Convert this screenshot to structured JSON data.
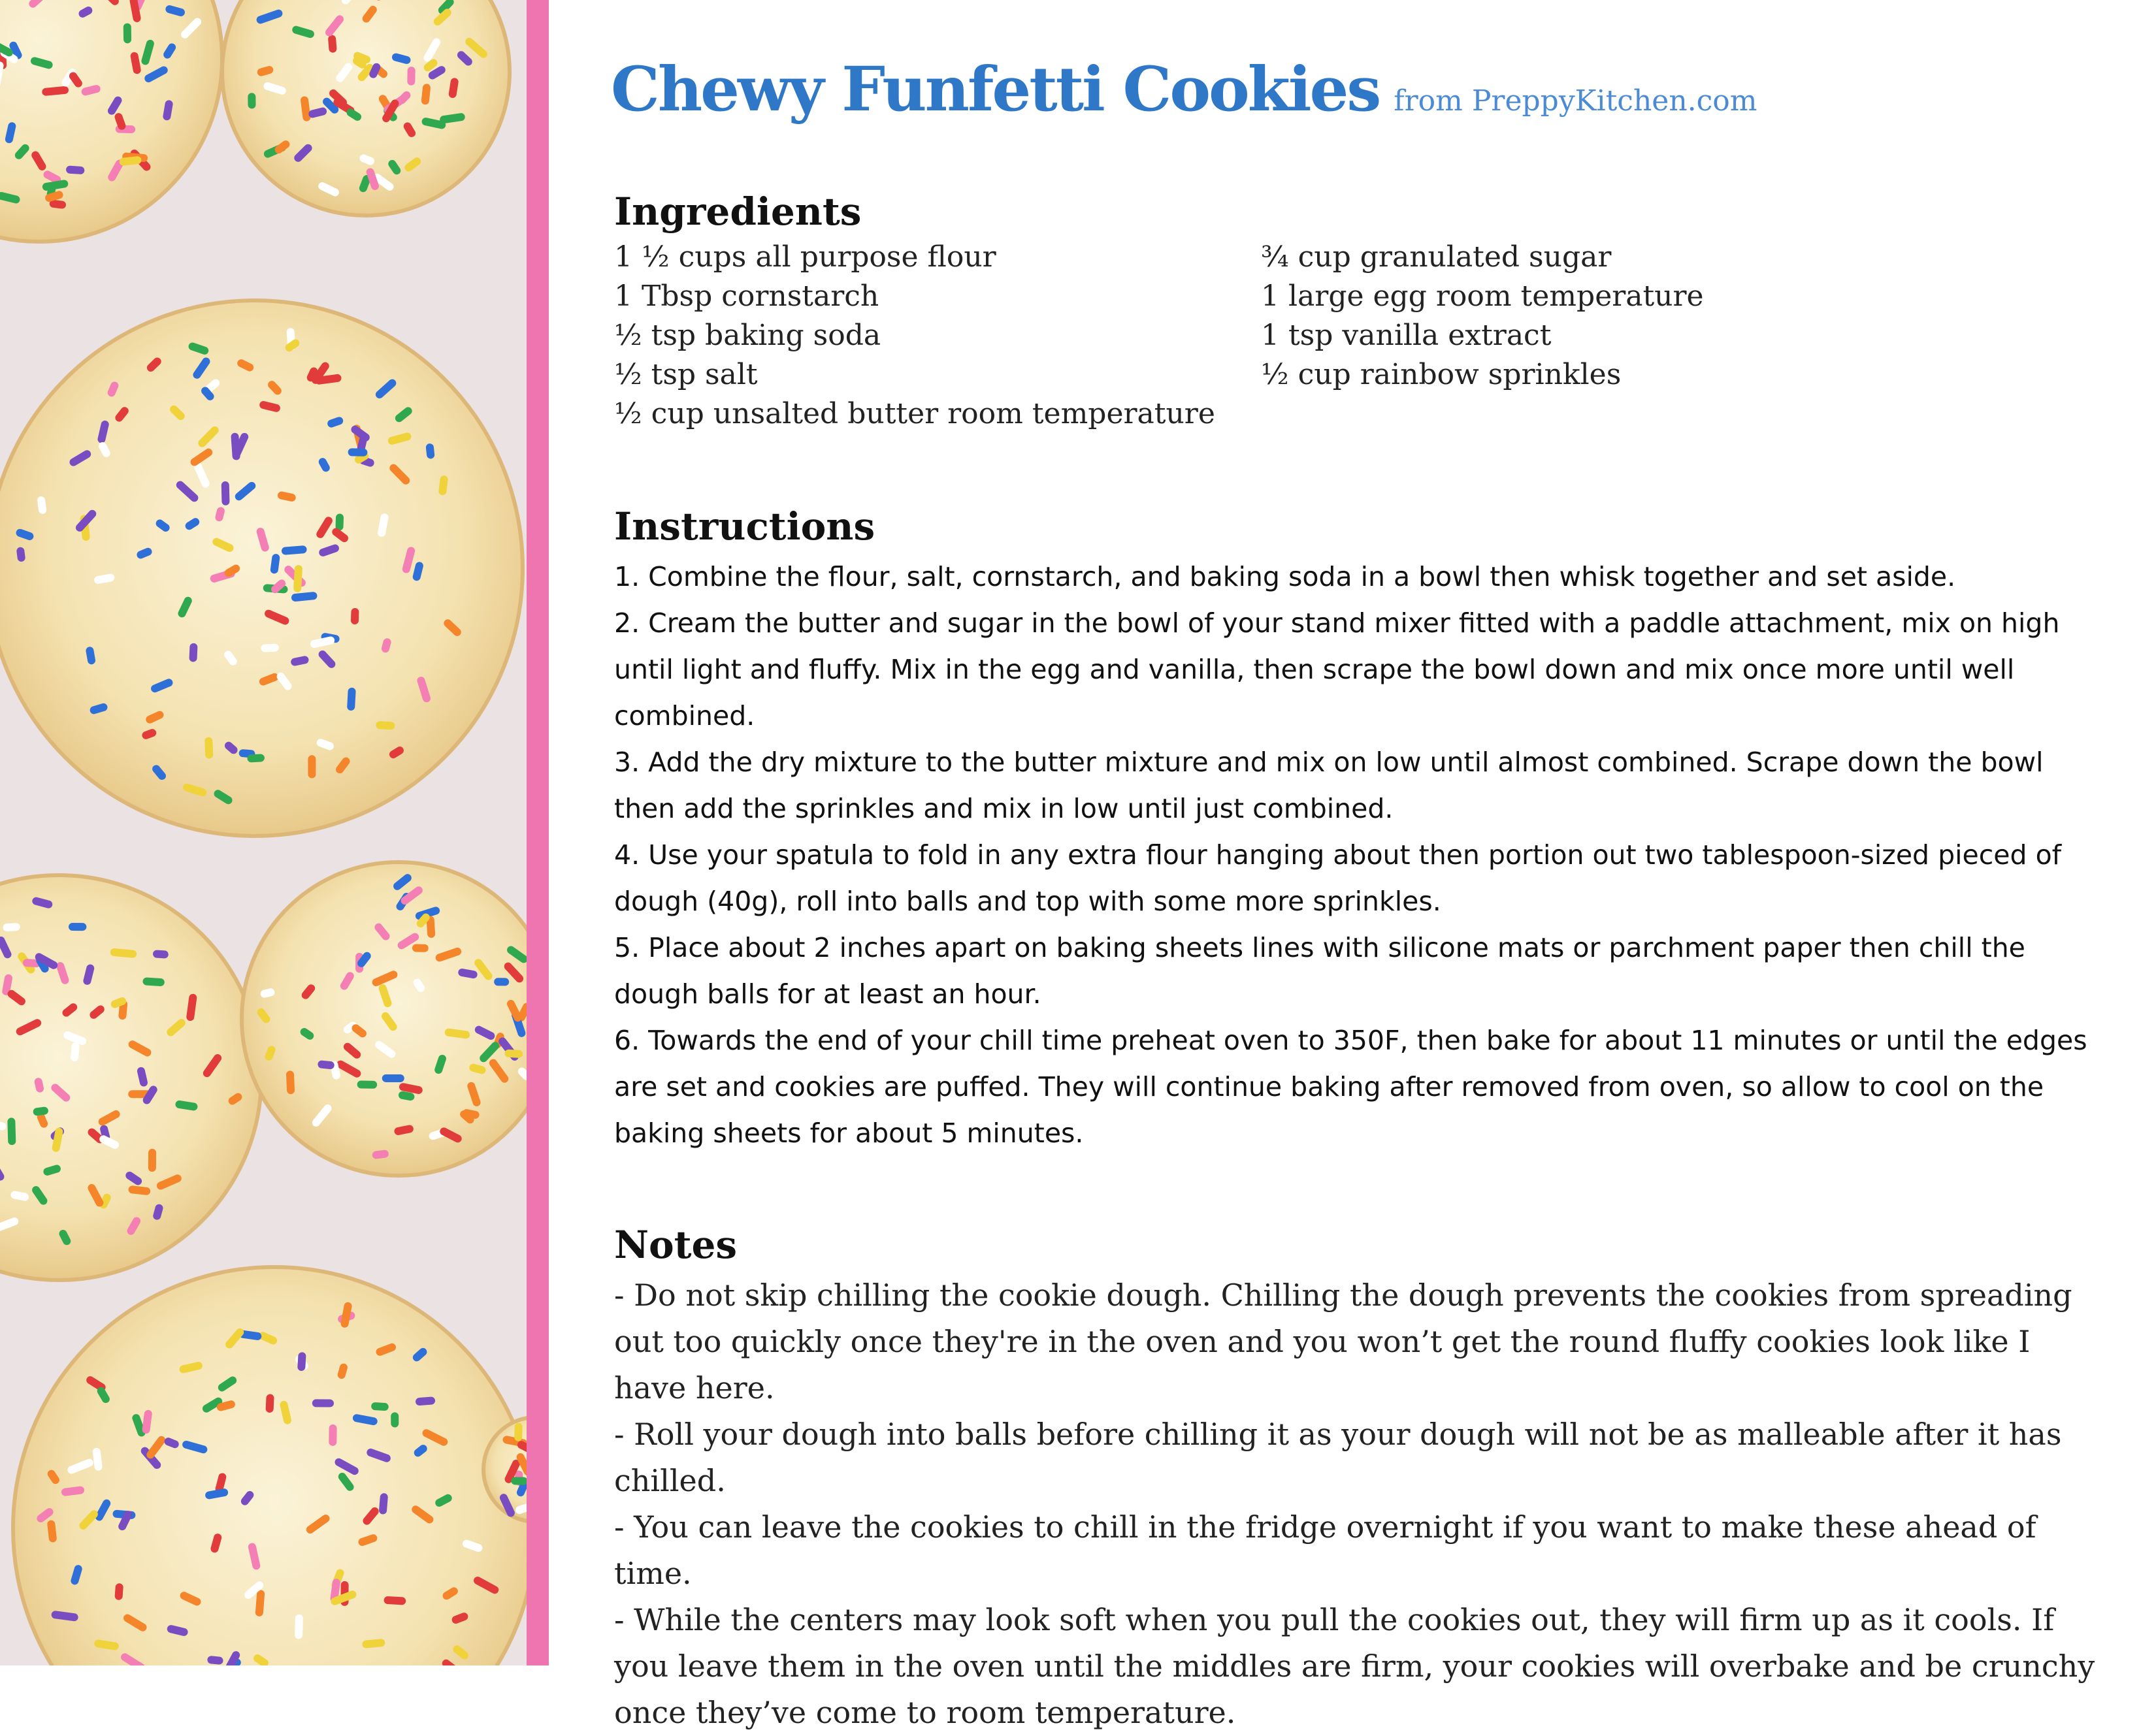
{
  "header": {
    "title": "Chewy Funfetti Cookies",
    "source": "from PreppyKitchen.com"
  },
  "photo": {
    "alt": "funfetti-cookies-photo",
    "accent_stripe_color": "#ef75b0"
  },
  "ingredients": {
    "heading": "Ingredients",
    "left": [
      "1 ½ cups all purpose flour",
      "1 Tbsp cornstarch",
      "½ tsp baking soda",
      "½ tsp salt",
      "½ cup unsalted butter room temperature"
    ],
    "right": [
      "¾ cup granulated sugar",
      "1 large egg room temperature",
      "1 tsp vanilla extract",
      "½ cup rainbow sprinkles"
    ]
  },
  "instructions": {
    "heading": "Instructions",
    "steps": [
      "1. Combine the flour, salt, cornstarch, and baking soda in a bowl then whisk together and set aside.",
      "2. Cream the butter and sugar in the bowl of your stand mixer fitted with a paddle attachment, mix on high until light and fluffy. Mix in the egg and vanilla, then scrape the bowl down and mix once more until well combined.",
      "3. Add the dry mixture to the butter mixture and mix on low until almost combined. Scrape down the bowl then add the sprinkles and mix in low until just combined.",
      "4. Use your spatula to fold in any extra flour hanging about then portion out two tablespoon-sized pieced of dough (40g), roll into balls and top with some more sprinkles.",
      "5. Place about 2 inches apart on baking sheets lines with silicone mats or parchment paper then chill the dough balls for at least an hour.",
      "6. Towards the end of your chill time preheat oven to 350F, then bake for about 11 minutes or until the edges are set and cookies are puffed. They will continue baking after removed from oven, so allow to cool on the baking sheets for about 5 minutes."
    ]
  },
  "notes": {
    "heading": "Notes",
    "items": [
      "- Do not skip chilling the cookie dough. Chilling the dough prevents the cookies from spreading out too quickly once they're in the oven and you won’t get the round fluffy cookies look like I have here.",
      "- Roll your dough into balls before chilling it as your dough will not be as malleable after it has chilled.",
      "- You can leave the cookies to chill in the fridge overnight if you want to make these ahead of time.",
      "- While the centers may look soft when you pull the cookies out, they will firm up as it cools. If you leave them in the oven until the middles are firm, your cookies will overbake and be crunchy once they’ve come to room temperature."
    ]
  }
}
